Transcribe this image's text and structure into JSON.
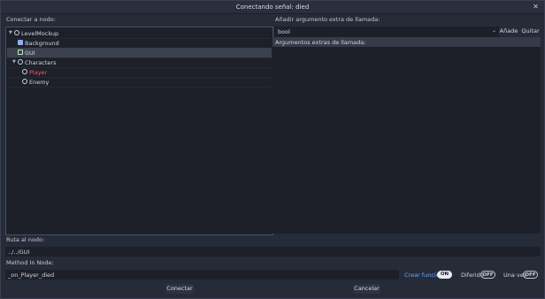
{
  "dialog": {
    "title": "Conectando señal: died",
    "close_icon": "close-icon"
  },
  "left": {
    "label": "Conectar a nodo:",
    "tree": [
      {
        "label": "LevelMockup",
        "icon": "node-circle-icon",
        "expanded": true,
        "depth": 0,
        "color": "#d0d4dc"
      },
      {
        "label": "Background",
        "icon": "texture-icon",
        "depth": 1,
        "color": "#d0d4dc"
      },
      {
        "label": "GUI",
        "icon": "control-square-icon",
        "depth": 1,
        "selected": true,
        "color": "#d0d4dc"
      },
      {
        "label": "Characters",
        "icon": "node-circle-icon",
        "expanded": true,
        "depth": 1,
        "color": "#d0d4dc"
      },
      {
        "label": "Player",
        "icon": "node-circle-icon",
        "depth": 2,
        "color": "#ff5a5a"
      },
      {
        "label": "Enemy",
        "icon": "node-circle-icon",
        "depth": 2,
        "color": "#d0d4dc"
      }
    ]
  },
  "right": {
    "label": "Añadir argumento extra de llamada:",
    "type_select": "bool",
    "add_label": "Añade",
    "remove_label": "Quitar",
    "args_header": "Argumentos extras de llamada:"
  },
  "path": {
    "label": "Ruta al nodo:",
    "value": "../../GUI"
  },
  "method": {
    "label": "Method In Node:",
    "value": "_on_Player_died"
  },
  "options": {
    "make_function_label": "Crear función",
    "make_function_state": "ON",
    "deferred_label": "Diferido",
    "deferred_state": "OFF",
    "oneshot_label": "Una vez",
    "oneshot_state": "OFF"
  },
  "buttons": {
    "connect": "Conectar",
    "cancel": "Cancelar"
  }
}
